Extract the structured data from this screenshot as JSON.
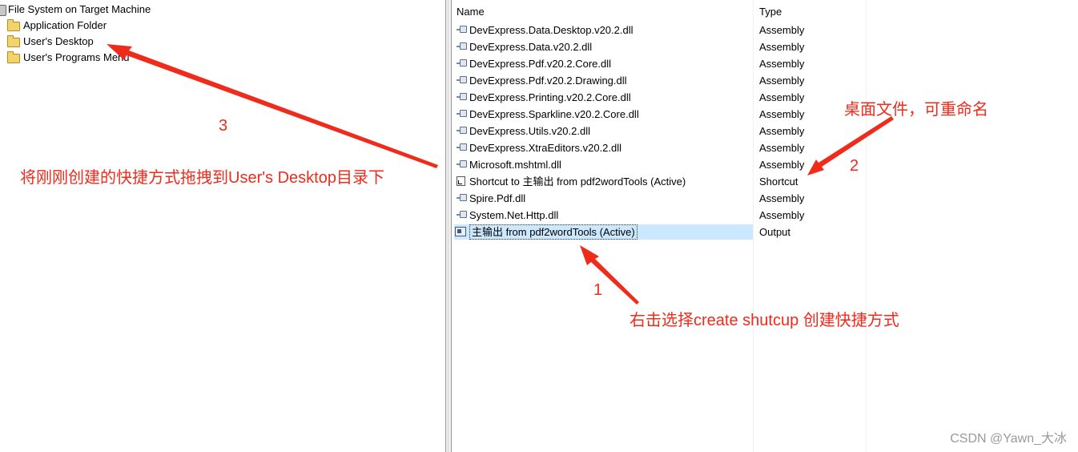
{
  "tree": {
    "root": "File System on Target Machine",
    "items": [
      {
        "label": "Application Folder"
      },
      {
        "label": "User's Desktop"
      },
      {
        "label": "User's Programs Menu"
      }
    ]
  },
  "list": {
    "headers": {
      "name": "Name",
      "type": "Type"
    },
    "rows": [
      {
        "name": "DevExpress.Data.Desktop.v20.2.dll",
        "type": "Assembly",
        "icon": "assembly-icon"
      },
      {
        "name": "DevExpress.Data.v20.2.dll",
        "type": "Assembly",
        "icon": "assembly-icon"
      },
      {
        "name": "DevExpress.Pdf.v20.2.Core.dll",
        "type": "Assembly",
        "icon": "assembly-icon"
      },
      {
        "name": "DevExpress.Pdf.v20.2.Drawing.dll",
        "type": "Assembly",
        "icon": "assembly-icon"
      },
      {
        "name": "DevExpress.Printing.v20.2.Core.dll",
        "type": "Assembly",
        "icon": "assembly-icon"
      },
      {
        "name": "DevExpress.Sparkline.v20.2.Core.dll",
        "type": "Assembly",
        "icon": "assembly-icon"
      },
      {
        "name": "DevExpress.Utils.v20.2.dll",
        "type": "Assembly",
        "icon": "assembly-icon"
      },
      {
        "name": "DevExpress.XtraEditors.v20.2.dll",
        "type": "Assembly",
        "icon": "assembly-icon"
      },
      {
        "name": "Microsoft.mshtml.dll",
        "type": "Assembly",
        "icon": "assembly-icon"
      },
      {
        "name": "Shortcut to 主输出 from pdf2wordTools (Active)",
        "type": "Shortcut",
        "icon": "shortcut-icon"
      },
      {
        "name": "Spire.Pdf.dll",
        "type": "Assembly",
        "icon": "assembly-icon"
      },
      {
        "name": "System.Net.Http.dll",
        "type": "Assembly",
        "icon": "assembly-icon"
      },
      {
        "name": "主输出 from pdf2wordTools (Active)",
        "type": "Output",
        "icon": "output-icon",
        "selected": true
      }
    ]
  },
  "annotations": {
    "drag_to_desktop": "将刚刚创建的快捷方式拖拽到User's Desktop目录下",
    "desktop_file_rename": "桌面文件，可重命名",
    "right_click_create_shortcut": "右击选择create shutcup 创建快捷方式",
    "step1": "1",
    "step2": "2",
    "step3": "3",
    "color": "#ef2b1c"
  },
  "watermark": "CSDN @Yawn_大冰"
}
